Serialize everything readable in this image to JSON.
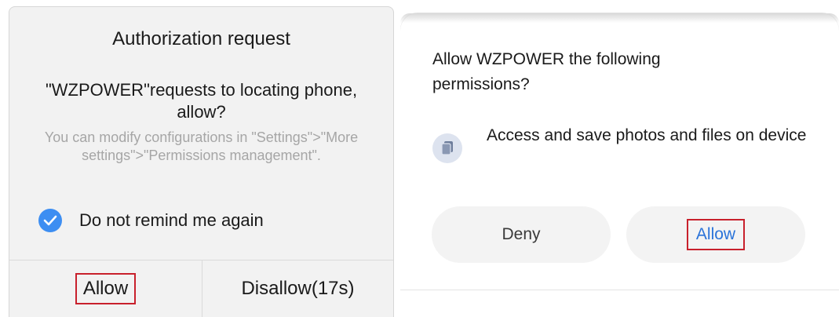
{
  "left_dialog": {
    "title": "Authorization request",
    "message": "\"WZPOWER\"requests to locating phone, allow?",
    "hint": "You can modify configurations in \"Settings\">\"More settings\">\"Permissions management\".",
    "checkbox_label": "Do not remind me again",
    "checkbox_checked": true,
    "allow_label": "Allow",
    "disallow_label": "Disallow(17s)"
  },
  "right_dialog": {
    "title": "Allow WZPOWER the following permissions?",
    "permission_text": "Access and save photos and files on device",
    "permission_icon": "files-icon",
    "deny_label": "Deny",
    "allow_label": "Allow"
  },
  "colors": {
    "accent_blue": "#3d8ef2",
    "allow_blue": "#2a73d9",
    "highlight_red": "#c8202c"
  }
}
